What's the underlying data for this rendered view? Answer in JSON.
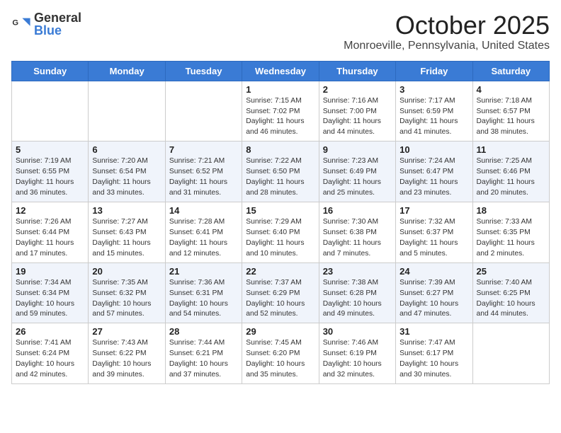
{
  "header": {
    "logo_general": "General",
    "logo_blue": "Blue",
    "month": "October 2025",
    "location": "Monroeville, Pennsylvania, United States"
  },
  "weekdays": [
    "Sunday",
    "Monday",
    "Tuesday",
    "Wednesday",
    "Thursday",
    "Friday",
    "Saturday"
  ],
  "weeks": [
    [
      {
        "day": "",
        "info": ""
      },
      {
        "day": "",
        "info": ""
      },
      {
        "day": "",
        "info": ""
      },
      {
        "day": "1",
        "info": "Sunrise: 7:15 AM\nSunset: 7:02 PM\nDaylight: 11 hours and 46 minutes."
      },
      {
        "day": "2",
        "info": "Sunrise: 7:16 AM\nSunset: 7:00 PM\nDaylight: 11 hours and 44 minutes."
      },
      {
        "day": "3",
        "info": "Sunrise: 7:17 AM\nSunset: 6:59 PM\nDaylight: 11 hours and 41 minutes."
      },
      {
        "day": "4",
        "info": "Sunrise: 7:18 AM\nSunset: 6:57 PM\nDaylight: 11 hours and 38 minutes."
      }
    ],
    [
      {
        "day": "5",
        "info": "Sunrise: 7:19 AM\nSunset: 6:55 PM\nDaylight: 11 hours and 36 minutes."
      },
      {
        "day": "6",
        "info": "Sunrise: 7:20 AM\nSunset: 6:54 PM\nDaylight: 11 hours and 33 minutes."
      },
      {
        "day": "7",
        "info": "Sunrise: 7:21 AM\nSunset: 6:52 PM\nDaylight: 11 hours and 31 minutes."
      },
      {
        "day": "8",
        "info": "Sunrise: 7:22 AM\nSunset: 6:50 PM\nDaylight: 11 hours and 28 minutes."
      },
      {
        "day": "9",
        "info": "Sunrise: 7:23 AM\nSunset: 6:49 PM\nDaylight: 11 hours and 25 minutes."
      },
      {
        "day": "10",
        "info": "Sunrise: 7:24 AM\nSunset: 6:47 PM\nDaylight: 11 hours and 23 minutes."
      },
      {
        "day": "11",
        "info": "Sunrise: 7:25 AM\nSunset: 6:46 PM\nDaylight: 11 hours and 20 minutes."
      }
    ],
    [
      {
        "day": "12",
        "info": "Sunrise: 7:26 AM\nSunset: 6:44 PM\nDaylight: 11 hours and 17 minutes."
      },
      {
        "day": "13",
        "info": "Sunrise: 7:27 AM\nSunset: 6:43 PM\nDaylight: 11 hours and 15 minutes."
      },
      {
        "day": "14",
        "info": "Sunrise: 7:28 AM\nSunset: 6:41 PM\nDaylight: 11 hours and 12 minutes."
      },
      {
        "day": "15",
        "info": "Sunrise: 7:29 AM\nSunset: 6:40 PM\nDaylight: 11 hours and 10 minutes."
      },
      {
        "day": "16",
        "info": "Sunrise: 7:30 AM\nSunset: 6:38 PM\nDaylight: 11 hours and 7 minutes."
      },
      {
        "day": "17",
        "info": "Sunrise: 7:32 AM\nSunset: 6:37 PM\nDaylight: 11 hours and 5 minutes."
      },
      {
        "day": "18",
        "info": "Sunrise: 7:33 AM\nSunset: 6:35 PM\nDaylight: 11 hours and 2 minutes."
      }
    ],
    [
      {
        "day": "19",
        "info": "Sunrise: 7:34 AM\nSunset: 6:34 PM\nDaylight: 10 hours and 59 minutes."
      },
      {
        "day": "20",
        "info": "Sunrise: 7:35 AM\nSunset: 6:32 PM\nDaylight: 10 hours and 57 minutes."
      },
      {
        "day": "21",
        "info": "Sunrise: 7:36 AM\nSunset: 6:31 PM\nDaylight: 10 hours and 54 minutes."
      },
      {
        "day": "22",
        "info": "Sunrise: 7:37 AM\nSunset: 6:29 PM\nDaylight: 10 hours and 52 minutes."
      },
      {
        "day": "23",
        "info": "Sunrise: 7:38 AM\nSunset: 6:28 PM\nDaylight: 10 hours and 49 minutes."
      },
      {
        "day": "24",
        "info": "Sunrise: 7:39 AM\nSunset: 6:27 PM\nDaylight: 10 hours and 47 minutes."
      },
      {
        "day": "25",
        "info": "Sunrise: 7:40 AM\nSunset: 6:25 PM\nDaylight: 10 hours and 44 minutes."
      }
    ],
    [
      {
        "day": "26",
        "info": "Sunrise: 7:41 AM\nSunset: 6:24 PM\nDaylight: 10 hours and 42 minutes."
      },
      {
        "day": "27",
        "info": "Sunrise: 7:43 AM\nSunset: 6:22 PM\nDaylight: 10 hours and 39 minutes."
      },
      {
        "day": "28",
        "info": "Sunrise: 7:44 AM\nSunset: 6:21 PM\nDaylight: 10 hours and 37 minutes."
      },
      {
        "day": "29",
        "info": "Sunrise: 7:45 AM\nSunset: 6:20 PM\nDaylight: 10 hours and 35 minutes."
      },
      {
        "day": "30",
        "info": "Sunrise: 7:46 AM\nSunset: 6:19 PM\nDaylight: 10 hours and 32 minutes."
      },
      {
        "day": "31",
        "info": "Sunrise: 7:47 AM\nSunset: 6:17 PM\nDaylight: 10 hours and 30 minutes."
      },
      {
        "day": "",
        "info": ""
      }
    ]
  ]
}
